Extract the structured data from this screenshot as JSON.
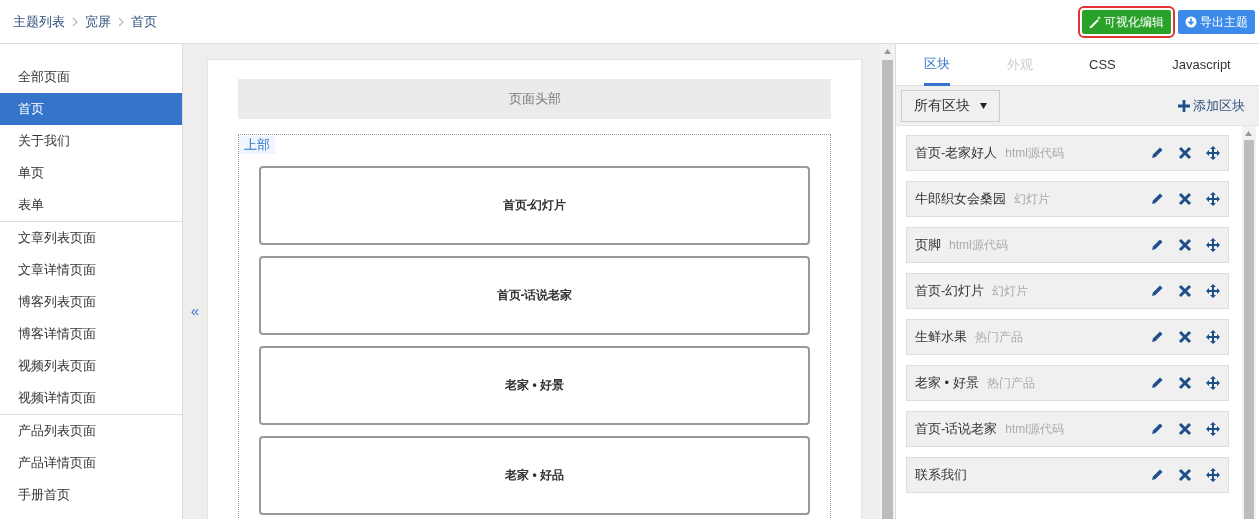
{
  "breadcrumb": [
    "主题列表",
    "宽屏",
    "首页"
  ],
  "actions": [
    {
      "label": "可视化编辑",
      "kind": "edit",
      "highlighted": true
    },
    {
      "label": "导出主题",
      "kind": "export",
      "highlighted": false
    }
  ],
  "sidebar": {
    "groups": [
      {
        "items": [
          {
            "label": "全部页面",
            "selected": false
          },
          {
            "label": "首页",
            "selected": true
          },
          {
            "label": "关于我们",
            "selected": false
          },
          {
            "label": "单页",
            "selected": false
          },
          {
            "label": "表单",
            "selected": false
          }
        ]
      },
      {
        "items": [
          {
            "label": "文章列表页面",
            "selected": false
          },
          {
            "label": "文章详情页面",
            "selected": false
          },
          {
            "label": "博客列表页面",
            "selected": false
          },
          {
            "label": "博客详情页面",
            "selected": false
          },
          {
            "label": "视频列表页面",
            "selected": false
          },
          {
            "label": "视频详情页面",
            "selected": false
          }
        ]
      },
      {
        "items": [
          {
            "label": "产品列表页面",
            "selected": false
          },
          {
            "label": "产品详情页面",
            "selected": false
          },
          {
            "label": "手册首页",
            "selected": false
          }
        ]
      }
    ]
  },
  "collapse_toggle": "«",
  "canvas": {
    "header": "页面头部",
    "region": {
      "label": "上部",
      "modules": [
        "首页-幻灯片",
        "首页-话说老家",
        "老家 • 好景",
        "老家 • 好品"
      ]
    }
  },
  "panel": {
    "tabs": [
      {
        "label": "区块",
        "selected": true,
        "disabled": false
      },
      {
        "label": "外观",
        "selected": false,
        "disabled": true
      },
      {
        "label": "CSS",
        "selected": false,
        "disabled": false
      },
      {
        "label": "Javascript",
        "selected": false,
        "disabled": false
      }
    ],
    "filter": {
      "value": "所有区块"
    },
    "add_button": "添加区块",
    "blocks": [
      {
        "name": "首页-老家好人",
        "type": "html源代码"
      },
      {
        "name": "牛郎织女会桑园",
        "type": "幻灯片"
      },
      {
        "name": "页脚",
        "type": "html源代码"
      },
      {
        "name": "首页-幻灯片",
        "type": "幻灯片"
      },
      {
        "name": "生鲜水果",
        "type": "热门产品"
      },
      {
        "name": "老家 • 好景",
        "type": "热门产品"
      },
      {
        "name": "首页-话说老家",
        "type": "html源代码"
      },
      {
        "name": "联系我们"
      }
    ]
  }
}
